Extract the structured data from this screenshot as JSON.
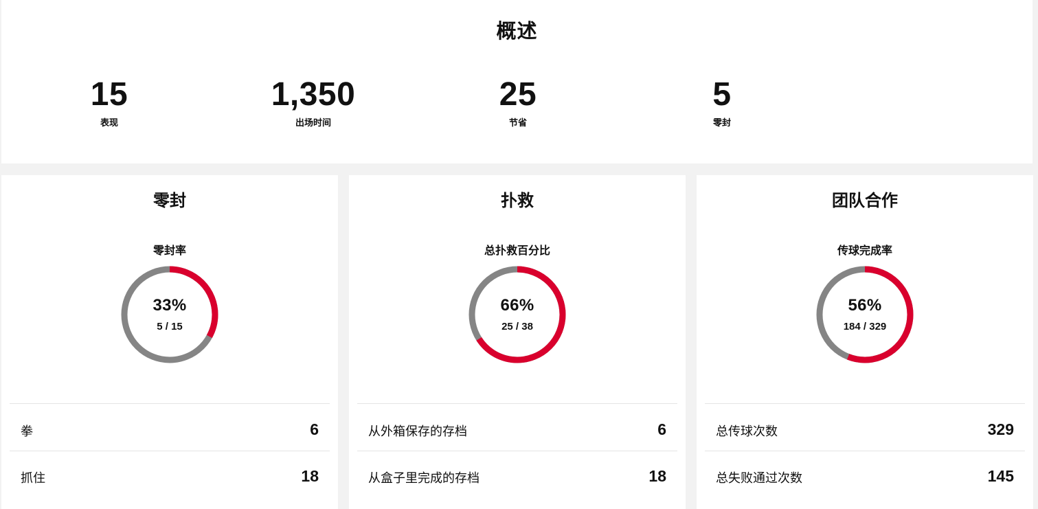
{
  "overview": {
    "title": "概述",
    "stats": [
      {
        "value": "15",
        "label": "表现"
      },
      {
        "value": "1,350",
        "label": "出场时间"
      },
      {
        "value": "25",
        "label": "节省"
      },
      {
        "value": "5",
        "label": "零封"
      }
    ]
  },
  "colors": {
    "accent": "#d9002d",
    "track": "#858585"
  },
  "cards": [
    {
      "title": "零封",
      "metric_title": "零封率",
      "percent": 33,
      "percent_text": "33%",
      "fraction": "5 / 15",
      "rows": [
        {
          "label": "拳",
          "value": "6"
        },
        {
          "label": "抓住",
          "value": "18"
        }
      ]
    },
    {
      "title": "扑救",
      "metric_title": "总扑救百分比",
      "percent": 66,
      "percent_text": "66%",
      "fraction": "25 / 38",
      "rows": [
        {
          "label": "从外箱保存的存档",
          "value": "6"
        },
        {
          "label": "从盒子里完成的存档",
          "value": "18"
        }
      ]
    },
    {
      "title": "团队合作",
      "metric_title": "传球完成率",
      "percent": 56,
      "percent_text": "56%",
      "fraction": "184 / 329",
      "rows": [
        {
          "label": "总传球次数",
          "value": "329"
        },
        {
          "label": "总失败通过次数",
          "value": "145"
        }
      ]
    }
  ]
}
